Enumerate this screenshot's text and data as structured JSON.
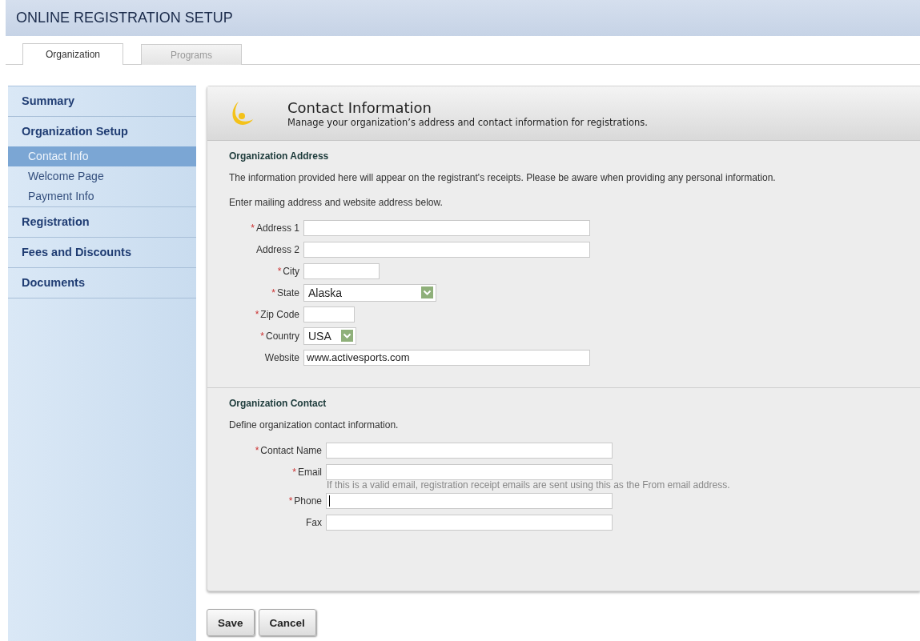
{
  "header": {
    "title": "ONLINE REGISTRATION SETUP"
  },
  "tabs": [
    {
      "label": "Organization",
      "selected": true
    },
    {
      "label": "Programs",
      "selected": false
    }
  ],
  "sidebar": {
    "items": [
      {
        "label": "Summary",
        "selected": false
      },
      {
        "label": "Organization Setup",
        "selected": false,
        "children": [
          {
            "label": "Contact Info",
            "selected": true
          },
          {
            "label": "Welcome Page",
            "selected": false
          },
          {
            "label": "Payment Info",
            "selected": false
          }
        ]
      },
      {
        "label": "Registration",
        "selected": false
      },
      {
        "label": "Fees and Discounts",
        "selected": false
      },
      {
        "label": "Documents",
        "selected": false
      }
    ]
  },
  "panel": {
    "title": "Contact Information",
    "subtitle": "Manage your organization’s address and contact information for registrations."
  },
  "sections": [
    {
      "heading": "Organization Address",
      "paragraphs": [
        "The information provided here will appear on the registrant's receipts. Please be aware when providing any personal information.",
        "Enter mailing address and website address below."
      ],
      "fields": [
        {
          "label": "Address 1",
          "required_mark": "*",
          "kind": "text"
        },
        {
          "label": "Address 2",
          "kind": "text"
        },
        {
          "label": "City",
          "required_mark": "*",
          "kind": "text"
        },
        {
          "label": "State",
          "required_mark": "*",
          "kind": "select",
          "value": "Alaska"
        },
        {
          "label": "Zip Code",
          "required_mark": "*",
          "kind": "text"
        },
        {
          "label": "Country",
          "required_mark": "*",
          "kind": "select",
          "value": "USA"
        },
        {
          "label": "Website",
          "kind": "text",
          "value": "www.activesports.com"
        }
      ]
    },
    {
      "heading": "Organization Contact",
      "paragraphs": [
        "Define organization contact information."
      ],
      "fields": [
        {
          "label": "Contact Name",
          "required_mark": "*",
          "kind": "text"
        },
        {
          "label": "Email",
          "required_mark": "*",
          "kind": "text",
          "hint": "If this is a valid email, registration receipt emails are sent using this as the From email address."
        },
        {
          "label": "Phone",
          "required_mark": "*",
          "kind": "text",
          "focused": true
        },
        {
          "label": "Fax",
          "kind": "text"
        }
      ]
    }
  ],
  "buttons": [
    "Save",
    "Cancel"
  ]
}
